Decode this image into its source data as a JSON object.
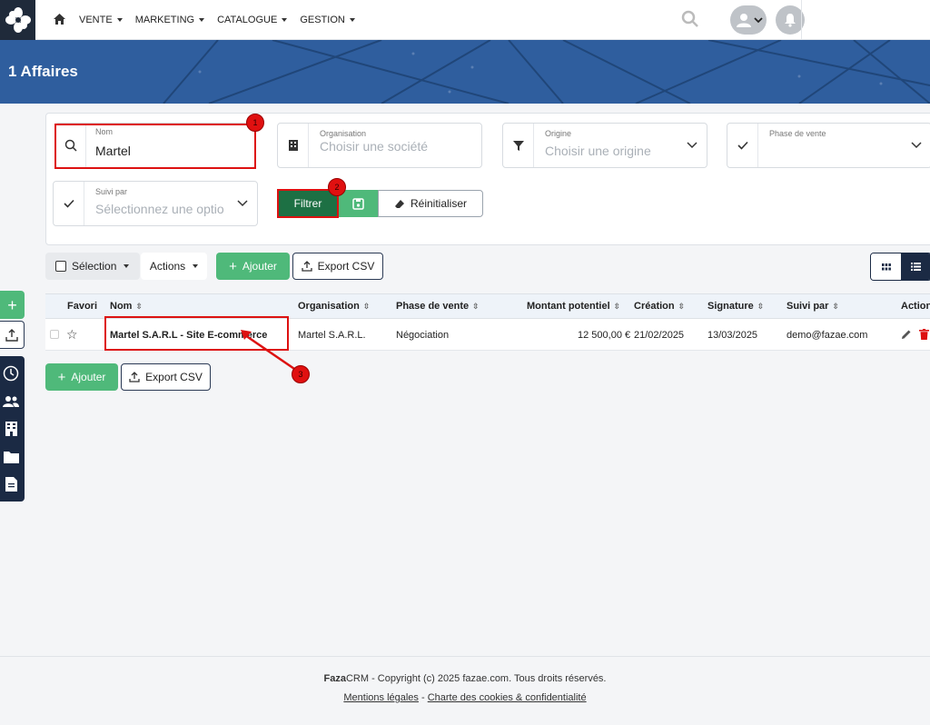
{
  "nav": {
    "items": [
      {
        "label": "VENTE"
      },
      {
        "label": "MARKETING"
      },
      {
        "label": "CATALOGUE"
      },
      {
        "label": "GESTION"
      }
    ]
  },
  "page": {
    "title": "1 Affaires"
  },
  "filters": {
    "nom": {
      "label": "Nom",
      "value": "Martel"
    },
    "organisation": {
      "label": "Organisation",
      "placeholder": "Choisir une société"
    },
    "origine": {
      "label": "Origine",
      "placeholder": "Choisir une origine"
    },
    "phase": {
      "label": "Phase de vente",
      "placeholder": ""
    },
    "suivi": {
      "label": "Suivi par",
      "placeholder": "Sélectionnez une optio"
    },
    "filter_button": "Filtrer",
    "reset_button": "Réinitialiser"
  },
  "annotations": [
    "1",
    "2",
    "3"
  ],
  "toolbar": {
    "selection_label": "Sélection",
    "actions_label": "Actions",
    "add_label": "Ajouter",
    "export_label": "Export CSV"
  },
  "table": {
    "columns": [
      "Favori",
      "Nom",
      "Organisation",
      "Phase de vente",
      "Montant potentiel",
      "Création",
      "Signature",
      "Suivi par",
      "Action"
    ],
    "rows": [
      {
        "nom": "Martel S.A.R.L - Site E-commerce",
        "organisation": "Martel S.A.R.L.",
        "phase": "Négociation",
        "montant": "12 500,00 €",
        "creation": "21/02/2025",
        "signature": "13/03/2025",
        "suivi": "demo@fazae.com"
      }
    ]
  },
  "bottom_toolbar": {
    "add_label": "Ajouter",
    "export_label": "Export CSV"
  },
  "footer": {
    "brand_bold": "Faza",
    "brand_rest": "CRM",
    "copyright": " - Copyright (c) 2025 fazae.com. Tous droits réservés.",
    "link_legal": "Mentions légales",
    "separator": " - ",
    "link_cookies": "Charte des cookies & confidentialité"
  },
  "colors": {
    "hero": "#2f5e9e",
    "primary_green": "#4fb97a",
    "dark_green": "#1d7044",
    "sidebar_dark": "#1b2a44",
    "annotation_red": "#d11111"
  }
}
